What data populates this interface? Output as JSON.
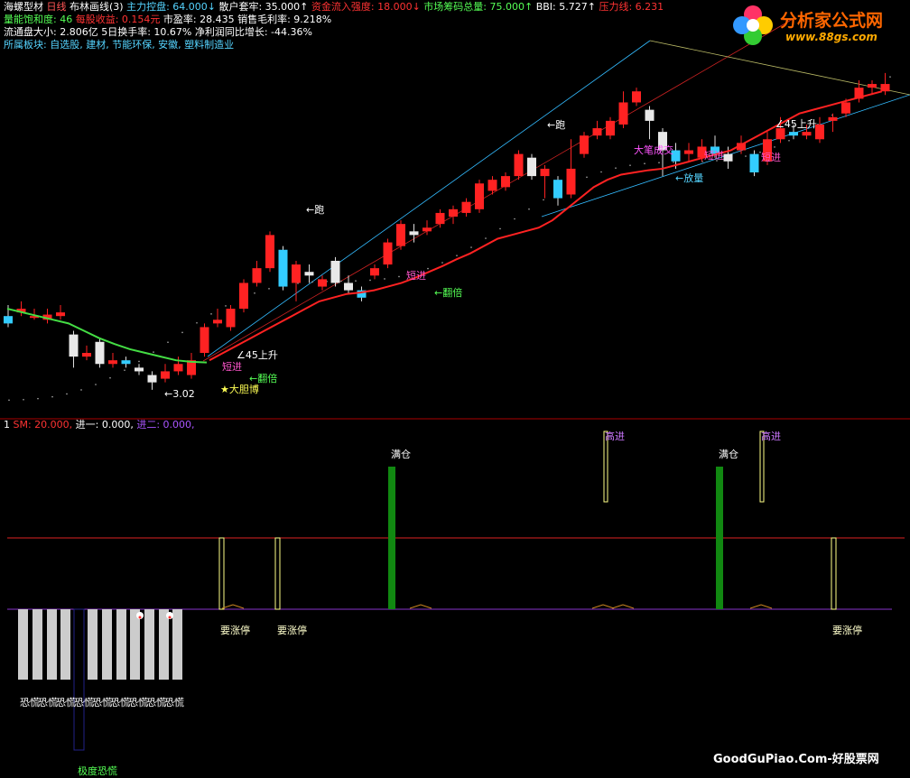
{
  "header": {
    "line1": [
      {
        "text": "海螺型材",
        "color": "#ffffff"
      },
      {
        "text": " 日线",
        "color": "#ff5555"
      },
      {
        "text": "  布林画线(3)",
        "color": "#ffffff"
      },
      {
        "text": " 主力控盘: 64.000↓",
        "color": "#55d4ff"
      },
      {
        "text": " 散户套牢: 35.000↑",
        "color": "#ffffff"
      },
      {
        "text": " 资金流入强度: 18.000↓",
        "color": "#ff3333"
      },
      {
        "text": " 市场筹码总量: 75.000↑",
        "color": "#55ff55"
      },
      {
        "text": " BBI: 5.727↑",
        "color": "#ffffff"
      },
      {
        "text": " 压力线: 6.231",
        "color": "#ff3333"
      }
    ],
    "line2": [
      {
        "text": "量能饱和度: 46",
        "color": "#55ff55"
      },
      {
        "text": "  每股收益: 0.154元",
        "color": "#ff3333"
      },
      {
        "text": " 市盈率: 28.435",
        "color": "#ffffff"
      },
      {
        "text": " 销售毛利率: 9.218%",
        "color": "#ffffff"
      }
    ],
    "line3": [
      {
        "text": "流通盘大小: 2.806亿  5日换手率: 10.67%",
        "color": "#ffffff"
      },
      {
        "text": " 净利润同比增长: -44.36%",
        "color": "#ffffff"
      }
    ],
    "line4": [
      {
        "text": "所属板块: 自选股, 建材, 节能环保, 安徽, 塑料制造业",
        "color": "#55d4ff"
      }
    ]
  },
  "sub_header": [
    {
      "text": "1",
      "color": "#ffffff"
    },
    {
      "text": " SM: 20.000,",
      "color": "#ff3333"
    },
    {
      "text": " 进一: 0.000,",
      "color": "#ffffff"
    },
    {
      "text": " 进二: 0.000,",
      "color": "#aa55ff"
    }
  ],
  "watermark": {
    "top_brand": "分析家公式网",
    "top_url": "www.88gs.com",
    "bottom": "GoodGuPiao.Com-好股票网"
  },
  "annotations": {
    "run": "←跑",
    "short_in": "短进",
    "double": "←翻倍",
    "rise45": "45上升",
    "bold": "★大胆博",
    "low": "3.02",
    "big_pen": "大笔成交",
    "volume": "←放量",
    "full_pos": "满仓",
    "hi_in": "高进",
    "limit_up": "要涨停",
    "panic": "恐慌",
    "extreme_panic": "极度恐慌"
  },
  "colors": {
    "up": "#ff2222",
    "down_cyan": "#33ccff",
    "down_white": "#e8e8e8",
    "ma_green": "#44dd44",
    "ma_red": "#ff2222",
    "bar_green": "#118811",
    "bar_yellow": "#ffff88",
    "grey_bar": "#cccccc",
    "divider": "#aa0000",
    "purple": "#aa55ff",
    "orange_icon": "#ff8800",
    "magenta": "#ff55ff",
    "pink": "#ff99ff"
  },
  "chart_data": {
    "type": "candlestick",
    "main": {
      "candles": [
        [
          5.1,
          5.0,
          5.25,
          4.95
        ],
        [
          5.15,
          5.2,
          5.3,
          5.1
        ],
        [
          5.1,
          5.1,
          5.2,
          5.05
        ],
        [
          5.05,
          5.12,
          5.2,
          5.0
        ],
        [
          5.1,
          5.15,
          5.25,
          5.05
        ],
        [
          4.85,
          4.55,
          4.9,
          4.4
        ],
        [
          4.55,
          4.6,
          4.7,
          4.5
        ],
        [
          4.75,
          4.45,
          4.8,
          4.4
        ],
        [
          4.45,
          4.5,
          4.6,
          4.4
        ],
        [
          4.5,
          4.45,
          4.55,
          4.4
        ],
        [
          4.4,
          4.35,
          4.45,
          4.3
        ],
        [
          4.3,
          4.2,
          4.35,
          4.1
        ],
        [
          4.25,
          4.35,
          4.45,
          4.2
        ],
        [
          4.35,
          4.45,
          4.55,
          4.3
        ],
        [
          4.3,
          4.5,
          4.6,
          4.25
        ],
        [
          4.6,
          4.95,
          5.0,
          4.55
        ],
        [
          5.0,
          5.05,
          5.2,
          4.95
        ],
        [
          4.95,
          5.2,
          5.25,
          4.9
        ],
        [
          5.2,
          5.55,
          5.6,
          5.15
        ],
        [
          5.55,
          5.75,
          5.85,
          5.5
        ],
        [
          5.75,
          6.2,
          6.25,
          5.7
        ],
        [
          6.0,
          5.5,
          6.05,
          5.45
        ],
        [
          5.55,
          5.8,
          5.85,
          5.3
        ],
        [
          5.7,
          5.65,
          5.8,
          5.55
        ],
        [
          5.5,
          5.6,
          5.65,
          5.45
        ],
        [
          5.85,
          5.55,
          5.9,
          5.5
        ],
        [
          5.55,
          5.45,
          5.65,
          5.4
        ],
        [
          5.45,
          5.35,
          5.5,
          5.3
        ],
        [
          5.65,
          5.75,
          5.8,
          5.6
        ],
        [
          5.8,
          6.1,
          6.15,
          5.75
        ],
        [
          6.05,
          6.35,
          6.4,
          6.0
        ],
        [
          6.25,
          6.2,
          6.35,
          6.1
        ],
        [
          6.25,
          6.3,
          6.4,
          6.2
        ],
        [
          6.35,
          6.5,
          6.55,
          6.3
        ],
        [
          6.45,
          6.55,
          6.6,
          6.35
        ],
        [
          6.5,
          6.65,
          6.7,
          6.45
        ],
        [
          6.55,
          6.9,
          6.95,
          6.5
        ],
        [
          6.8,
          6.95,
          7.0,
          6.75
        ],
        [
          6.85,
          7.0,
          7.05,
          6.8
        ],
        [
          7.0,
          7.3,
          7.35,
          6.95
        ],
        [
          7.25,
          7.0,
          7.3,
          6.95
        ],
        [
          7.0,
          7.1,
          7.15,
          6.7
        ],
        [
          6.95,
          6.7,
          7.0,
          6.6
        ],
        [
          6.75,
          7.1,
          7.5,
          6.7
        ],
        [
          7.3,
          7.55,
          7.6,
          7.25
        ],
        [
          7.55,
          7.65,
          7.75,
          7.5
        ],
        [
          7.55,
          7.75,
          7.8,
          7.5
        ],
        [
          7.7,
          8.0,
          8.15,
          7.65
        ],
        [
          8.0,
          8.15,
          8.2,
          7.95
        ],
        [
          7.9,
          7.75,
          7.95,
          7.5
        ],
        [
          7.6,
          7.35,
          7.65,
          7.0
        ],
        [
          7.35,
          7.2,
          7.45,
          7.1
        ],
        [
          7.3,
          7.35,
          7.45,
          7.2
        ],
        [
          7.25,
          7.4,
          7.5,
          7.2
        ],
        [
          7.4,
          7.3,
          7.55,
          7.25
        ],
        [
          7.3,
          7.2,
          7.4,
          7.1
        ],
        [
          7.35,
          7.45,
          7.55,
          7.3
        ],
        [
          7.3,
          7.05,
          7.35,
          7.0
        ],
        [
          7.2,
          7.5,
          7.6,
          7.15
        ],
        [
          7.5,
          7.65,
          7.8,
          7.45
        ],
        [
          7.6,
          7.55,
          7.7,
          7.5
        ],
        [
          7.55,
          7.6,
          7.7,
          7.5
        ],
        [
          7.5,
          7.7,
          7.8,
          7.45
        ],
        [
          7.75,
          7.8,
          7.85,
          7.6
        ],
        [
          7.85,
          8.0,
          8.05,
          7.8
        ],
        [
          8.05,
          8.2,
          8.3,
          8.0
        ],
        [
          8.2,
          8.25,
          8.3,
          8.1
        ],
        [
          8.15,
          8.25,
          8.4,
          8.1
        ]
      ],
      "ma_green": [
        5.2,
        5.15,
        5.1,
        5.05,
        5.0,
        4.9,
        4.8,
        4.72,
        4.65,
        4.6,
        4.55,
        4.5,
        4.48,
        4.47
      ],
      "ma_red": [
        4.5,
        4.6,
        4.7,
        4.8,
        4.9,
        5.0,
        5.1,
        5.2,
        5.3,
        5.35,
        5.4,
        5.42,
        5.45,
        5.5,
        5.55,
        5.62,
        5.7,
        5.78,
        5.87,
        5.95,
        6.05,
        6.15,
        6.2,
        6.25,
        6.3,
        6.4,
        6.55,
        6.7,
        6.85,
        6.95,
        7.02,
        7.05,
        7.08,
        7.1,
        7.15,
        7.2,
        7.25,
        7.3,
        7.35,
        7.45,
        7.55,
        7.65,
        7.75,
        7.85,
        7.9,
        7.95,
        8.0,
        8.05,
        8.1,
        8.15
      ]
    },
    "sub": {
      "series_names": [
        "SM",
        "进一",
        "进二"
      ],
      "values": [
        20.0,
        0.0,
        0.0
      ]
    }
  }
}
